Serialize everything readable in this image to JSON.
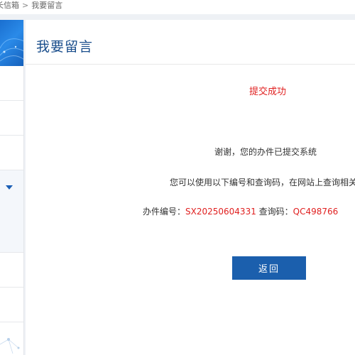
{
  "breadcrumb": {
    "items": [
      "长信箱",
      "我要留言"
    ],
    "separator": ">"
  },
  "main": {
    "title": "我要留言",
    "success_text": "提交成功",
    "thanks_text": "谢谢，您的办件已提交系统",
    "notice_text": "您可以使用以下编号和查询码，在网站上查询相关处",
    "case_label": "办件编号：",
    "case_number": "SX20250604331",
    "query_label": " 查询码：",
    "query_code": "QC498766",
    "back_label": "返回"
  },
  "sidebar": {
    "expand_icon": "chevron-down-icon"
  },
  "colors": {
    "title": "#1a4e8c",
    "success": "#e02020",
    "button": "#1b5fad",
    "banner": "#1a6fd0"
  }
}
